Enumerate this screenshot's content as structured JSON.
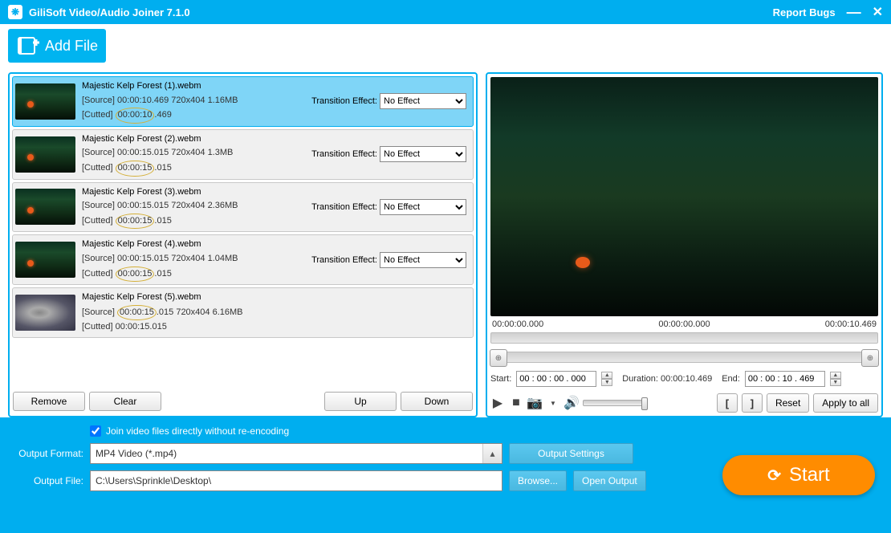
{
  "titlebar": {
    "title": "GiliSoft Video/Audio Joiner 7.1.0",
    "report": "Report Bugs"
  },
  "toolbar": {
    "add_file": "Add File"
  },
  "trans_label": "Transition Effect:",
  "trans_value": "No Effect",
  "files": [
    {
      "name": "Majestic Kelp Forest (1).webm",
      "src": "[Source]  00:00:10.469  720x404  1.16MB",
      "cut1": "[Cutted]  ",
      "cut_t": "00:00:10",
      "cut2": ".469",
      "sel": true
    },
    {
      "name": "Majestic Kelp Forest (2).webm",
      "src": "[Source]  00:00:15.015  720x404  1.3MB",
      "cut1": "[Cutted]  ",
      "cut_t": "00:00:15",
      "cut2": ".015",
      "sel": false
    },
    {
      "name": "Majestic Kelp Forest (3).webm",
      "src": "[Source]  00:00:15.015  720x404  2.36MB",
      "cut1": "[Cutted]  ",
      "cut_t": "00:00:15",
      "cut2": ".015",
      "sel": false
    },
    {
      "name": "Majestic Kelp Forest (4).webm",
      "src": "[Source]  00:00:15.015  720x404  1.04MB",
      "cut1": "[Cutted]  ",
      "cut_t": "00:00:15",
      "cut2": ".015",
      "sel": false
    },
    {
      "name": "Majestic Kelp Forest (5).webm",
      "src": "[Source]  00:00:15.015  720x404  6.16MB",
      "cut1": "[Cutted]  00:00:15.015",
      "cut_t": "",
      "cut2": "",
      "sel": false,
      "seal": true,
      "notrans": true,
      "circ_src": true
    }
  ],
  "list_buttons": {
    "remove": "Remove",
    "clear": "Clear",
    "up": "Up",
    "down": "Down"
  },
  "preview": {
    "t0": "00:00:00.000",
    "t1": "00:00:00.000",
    "t2": "00:00:10.469",
    "start_lbl": "Start:",
    "start_val": "00 : 00 : 00 . 000",
    "dur_lbl": "Duration: 00:00:10.469",
    "end_lbl": "End:",
    "end_val": "00 : 00 : 10 . 469",
    "reset": "Reset",
    "apply": "Apply to all"
  },
  "bottom": {
    "check": "Join video files directly without re-encoding",
    "format_lbl": "Output Format:",
    "format_val": "MP4 Video (*.mp4)",
    "settings": "Output Settings",
    "file_lbl": "Output File:",
    "file_val": "C:\\Users\\Sprinkle\\Desktop\\",
    "browse": "Browse...",
    "open": "Open Output",
    "start": "Start"
  }
}
